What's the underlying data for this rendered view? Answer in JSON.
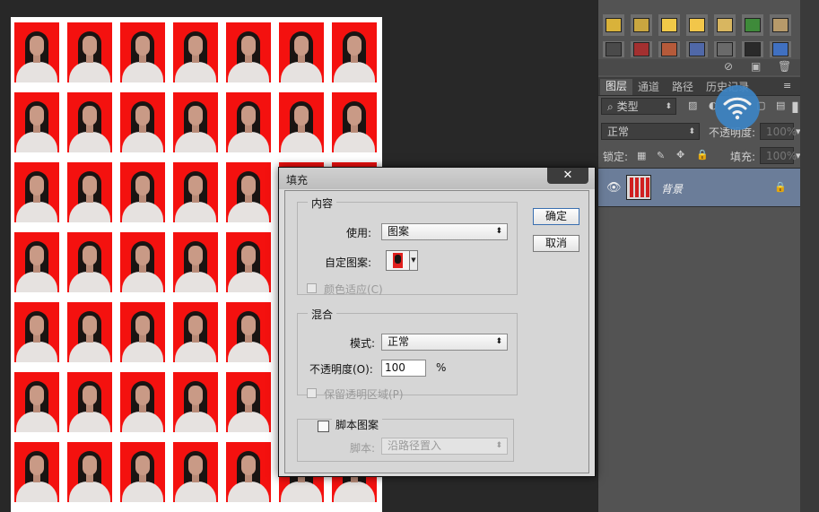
{
  "canvas": {
    "background_color": "#282828",
    "paper_color": "#ffffff",
    "photo_background_color": "#f4110f",
    "photo_grid": {
      "columns": 7,
      "rows": 7
    }
  },
  "styles_panel": {
    "icons": [
      "no-style-icon",
      "new-style-icon",
      "trash-icon"
    ]
  },
  "layers_panel": {
    "tabs": [
      {
        "label": "图层",
        "active": true
      },
      {
        "label": "通道",
        "active": false
      },
      {
        "label": "路径",
        "active": false
      },
      {
        "label": "历史记录",
        "active": false
      }
    ],
    "filter_label": "类型",
    "blend_mode": "正常",
    "opacity_label": "不透明度:",
    "opacity_value": "100%",
    "lock_label": "锁定:",
    "fill_label": "填充:",
    "fill_value": "100%",
    "layer": {
      "name": "背景",
      "locked": true,
      "visible": true
    }
  },
  "dialog": {
    "title": "填充",
    "close_glyph": "✕",
    "ok_label": "确定",
    "cancel_label": "取消",
    "content_group": {
      "title": "内容",
      "use_label": "使用:",
      "use_value": "图案",
      "custom_pattern_label": "自定图案:",
      "color_adapt_label": "颜色适应(C)",
      "color_adapt_checked": false,
      "color_adapt_enabled": false
    },
    "blend_group": {
      "title": "混合",
      "mode_label": "模式:",
      "mode_value": "正常",
      "opacity_label": "不透明度(O):",
      "opacity_value": "100",
      "opacity_unit": "%",
      "preserve_transparency_label": "保留透明区域(P)",
      "preserve_transparency_enabled": false
    },
    "script_group": {
      "title": "脚本图案",
      "checked": false,
      "script_label": "脚本:",
      "script_value": "沿路径置入"
    }
  }
}
